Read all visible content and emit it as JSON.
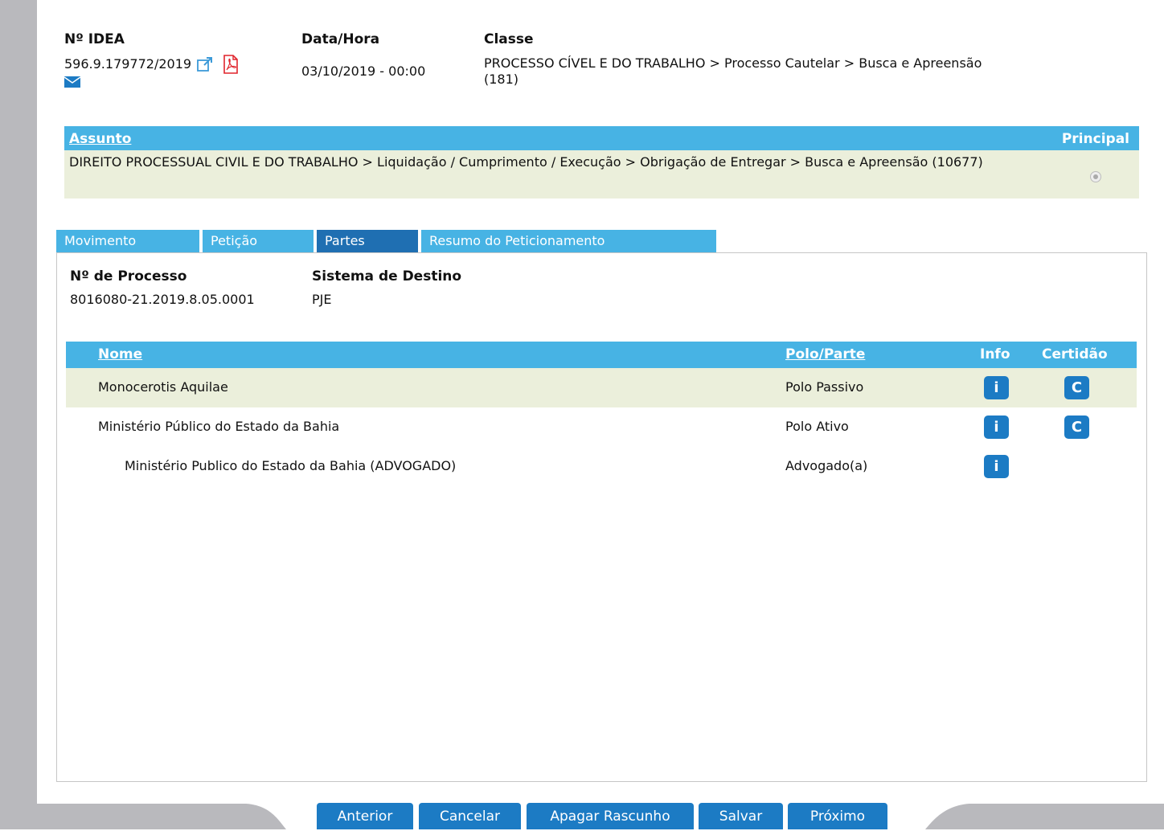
{
  "header": {
    "idea_label": "Nº IDEA",
    "idea_value": "596.9.179772/2019",
    "data_label": "Data/Hora",
    "data_value": "03/10/2019 - 00:00",
    "classe_label": "Classe",
    "classe_value": "PROCESSO CÍVEL E DO TRABALHO > Processo Cautelar > Busca e Apreensão (181)"
  },
  "assunto": {
    "label": "Assunto",
    "principal_label": "Principal",
    "text": "DIREITO PROCESSUAL CIVIL E DO TRABALHO > Liquidação / Cumprimento / Execução > Obrigação de Entregar > Busca e Apreensão (10677)"
  },
  "tabs": [
    {
      "label": "Movimento",
      "active": false
    },
    {
      "label": "Petição",
      "active": false
    },
    {
      "label": "Partes",
      "active": true
    },
    {
      "label": "Resumo do Peticionamento",
      "active": false
    }
  ],
  "processo": {
    "num_label": "Nº de Processo",
    "num_value": "8016080-21.2019.8.05.0001",
    "sistema_label": "Sistema de Destino",
    "sistema_value": "PJE"
  },
  "partes_table": {
    "headers": {
      "nome": "Nome",
      "polo": "Polo/Parte",
      "info": "Info",
      "certidao": "Certidão"
    },
    "rows": [
      {
        "nome": "Monocerotis Aquilae",
        "polo": "Polo Passivo",
        "info_btn": "i",
        "cert_btn": "C"
      },
      {
        "nome": "Ministério Público do Estado da Bahia",
        "polo": "Polo Ativo",
        "info_btn": "i",
        "cert_btn": "C"
      },
      {
        "nome": "Ministério Publico do Estado da Bahia (ADVOGADO)",
        "polo": "Advogado(a)",
        "info_btn": "i"
      }
    ]
  },
  "footer": {
    "anterior": "Anterior",
    "cancelar": "Cancelar",
    "apagar": "Apagar Rascunho",
    "salvar": "Salvar",
    "proximo": "Próximo"
  },
  "colors": {
    "header_blue": "#47b3e4",
    "button_blue": "#1c7bc4",
    "row_highlight": "#ebefdb",
    "pdf_red": "#e0242c"
  }
}
